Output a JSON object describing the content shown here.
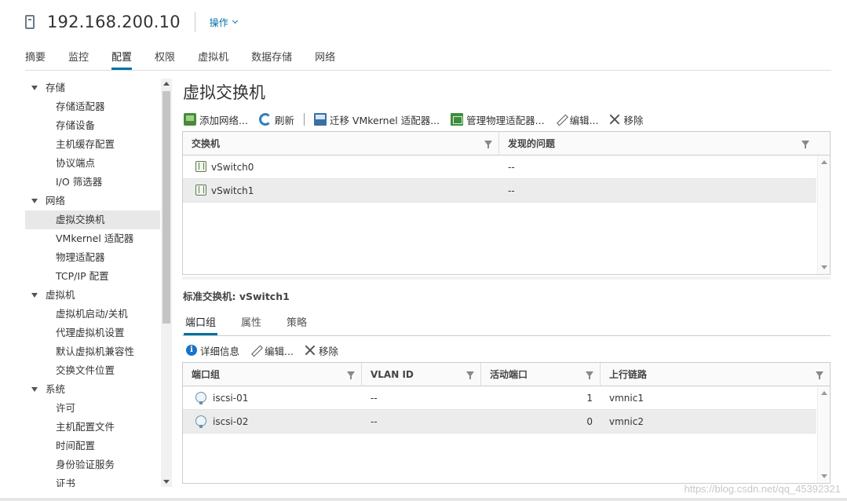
{
  "header": {
    "host_title": "192.168.200.10",
    "actions_label": "操作"
  },
  "tabs": [
    {
      "label": "摘要"
    },
    {
      "label": "监控"
    },
    {
      "label": "配置",
      "active": true
    },
    {
      "label": "权限"
    },
    {
      "label": "虚拟机"
    },
    {
      "label": "数据存储"
    },
    {
      "label": "网络"
    }
  ],
  "tree": {
    "storage": {
      "label": "存储",
      "items": [
        "存储适配器",
        "存储设备",
        "主机缓存配置",
        "协议端点",
        "I/O 筛选器"
      ]
    },
    "network": {
      "label": "网络",
      "items": [
        "虚拟交换机",
        "VMkernel 适配器",
        "物理适配器",
        "TCP/IP 配置"
      ]
    },
    "vm": {
      "label": "虚拟机",
      "items": [
        "虚拟机启动/关机",
        "代理虚拟机设置",
        "默认虚拟机兼容性",
        "交换文件位置"
      ]
    },
    "system": {
      "label": "系统",
      "items": [
        "许可",
        "主机配置文件",
        "时间配置",
        "身份验证服务",
        "证书"
      ]
    },
    "selected": "虚拟交换机"
  },
  "main": {
    "title": "虚拟交换机",
    "toolbar": {
      "add_network": "添加网络...",
      "refresh": "刷新",
      "migrate_vmk": "迁移 VMkernel 适配器...",
      "manage_phys": "管理物理适配器...",
      "edit": "编辑...",
      "remove": "移除"
    },
    "switch_grid": {
      "headers": [
        "交换机",
        "发现的问题"
      ],
      "rows": [
        {
          "name": "vSwitch0",
          "issue": "--"
        },
        {
          "name": "vSwitch1",
          "issue": "--",
          "selected": true
        }
      ]
    },
    "std_switch_title": "标准交换机: vSwitch1",
    "subtabs": [
      {
        "label": "端口组",
        "active": true
      },
      {
        "label": "属性"
      },
      {
        "label": "策略"
      }
    ],
    "pg_toolbar": {
      "details": "详细信息",
      "edit": "编辑...",
      "remove": "移除"
    },
    "pg_grid": {
      "headers": [
        "端口组",
        "VLAN ID",
        "活动端口",
        "上行链路"
      ],
      "rows": [
        {
          "name": "iscsi-01",
          "vlan": "--",
          "active_ports": "1",
          "uplink": "vmnic1"
        },
        {
          "name": "iscsi-02",
          "vlan": "--",
          "active_ports": "0",
          "uplink": "vmnic2",
          "selected": true
        }
      ]
    }
  },
  "watermark": "https://blog.csdn.net/qq_45392321"
}
